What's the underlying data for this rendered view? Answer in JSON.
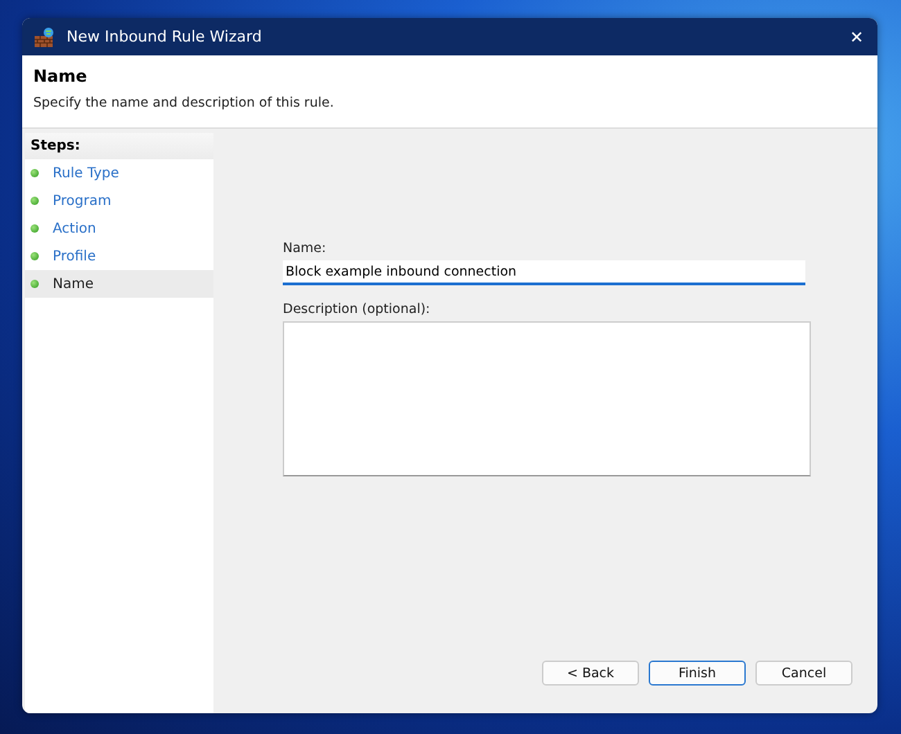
{
  "window": {
    "title": "New Inbound Rule Wizard",
    "close": "✕"
  },
  "header": {
    "title": "Name",
    "subtitle": "Specify the name and description of this rule."
  },
  "steps": {
    "heading": "Steps:",
    "items": [
      {
        "label": "Rule Type",
        "selected": false
      },
      {
        "label": "Program",
        "selected": false
      },
      {
        "label": "Action",
        "selected": false
      },
      {
        "label": "Profile",
        "selected": false
      },
      {
        "label": "Name",
        "selected": true
      }
    ]
  },
  "form": {
    "name_label": "Name:",
    "name_value": "Block example inbound connection",
    "description_label": "Description (optional):"
  },
  "buttons": [
    {
      "label": "< Back",
      "focused": false
    },
    {
      "label": "Finish",
      "focused": true
    },
    {
      "label": "Cancel",
      "focused": false
    }
  ]
}
